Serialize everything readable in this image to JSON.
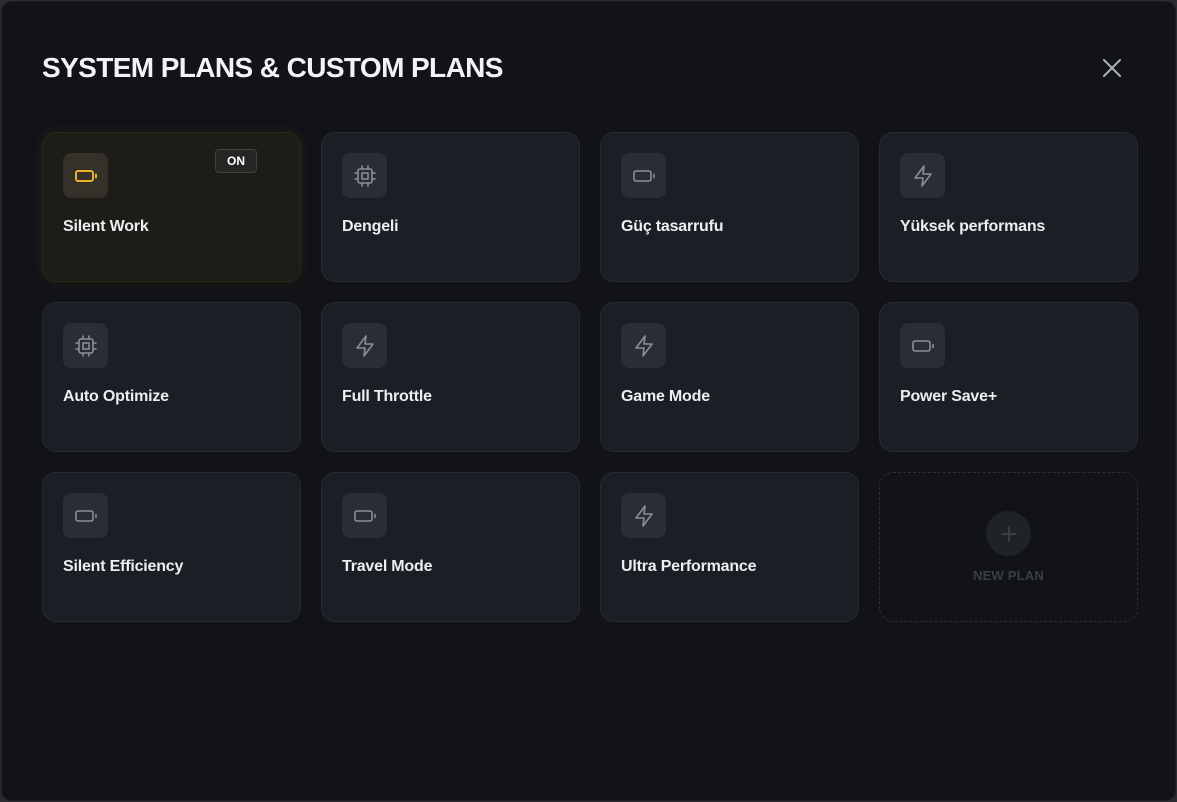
{
  "header": {
    "title": "SYSTEM PLANS & CUSTOM PLANS",
    "close_icon": "close-icon"
  },
  "colors": {
    "background": "#111317",
    "card": "#1b1e24",
    "active_accent": "#e6b325",
    "icon_muted": "#8a8e96"
  },
  "plans": [
    {
      "label": "Silent Work",
      "icon": "battery-icon",
      "active": true,
      "badge": "ON"
    },
    {
      "label": "Dengeli",
      "icon": "cpu-icon",
      "active": false
    },
    {
      "label": "Güç tasarrufu",
      "icon": "battery-icon",
      "active": false
    },
    {
      "label": "Yüksek performans",
      "icon": "lightning-icon",
      "active": false
    },
    {
      "label": "Auto Optimize",
      "icon": "cpu-icon",
      "active": false
    },
    {
      "label": "Full Throttle",
      "icon": "lightning-icon",
      "active": false
    },
    {
      "label": "Game Mode",
      "icon": "lightning-icon",
      "active": false
    },
    {
      "label": "Power Save+",
      "icon": "battery-icon",
      "active": false
    },
    {
      "label": "Silent Efficiency",
      "icon": "battery-icon",
      "active": false
    },
    {
      "label": "Travel Mode",
      "icon": "battery-icon",
      "active": false
    },
    {
      "label": "Ultra Performance",
      "icon": "lightning-icon",
      "active": false
    }
  ],
  "new_plan": {
    "label": "NEW PLAN",
    "icon": "plus-icon"
  }
}
